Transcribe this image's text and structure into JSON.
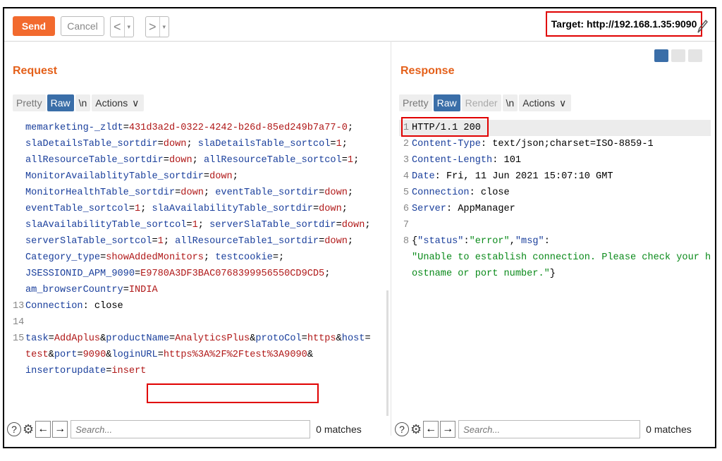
{
  "toolbar": {
    "send_label": "Send",
    "cancel_label": "Cancel",
    "back_glyph": "<",
    "forward_glyph": ">",
    "caret_glyph": "▾",
    "target_text": "Target: http://192.168.1.35:9090",
    "edit_icon": "pencil-icon"
  },
  "layout_icons": [
    "split-horizontal-icon",
    "split-vertical-icon",
    "single-pane-icon"
  ],
  "colors": {
    "accent": "#f26a2e",
    "active_tab": "#3a6ea8",
    "highlight": "#e00000"
  },
  "request": {
    "title": "Request",
    "tabs": [
      "Pretty",
      "Raw",
      "\\n",
      "Actions"
    ],
    "lines": [
      {
        "num": "",
        "parts": [
          {
            "t": "memarketing-_zldt",
            "c": "k"
          },
          {
            "t": "=",
            "c": "p"
          },
          {
            "t": "431d3a2d-0322-4242-b26d-85ed249b7a77-0",
            "c": "v"
          },
          {
            "t": ";",
            "c": "p"
          }
        ]
      },
      {
        "num": "",
        "parts": [
          {
            "t": "slaDetailsTable_sortdir",
            "c": "k"
          },
          {
            "t": "=",
            "c": "p"
          },
          {
            "t": "down",
            "c": "v"
          },
          {
            "t": "; ",
            "c": "p"
          },
          {
            "t": "slaDetailsTable_sortcol",
            "c": "k"
          },
          {
            "t": "=",
            "c": "p"
          },
          {
            "t": "1",
            "c": "v"
          },
          {
            "t": ";",
            "c": "p"
          }
        ]
      },
      {
        "num": "",
        "parts": [
          {
            "t": "allResourceTable_sortdir",
            "c": "k"
          },
          {
            "t": "=",
            "c": "p"
          },
          {
            "t": "down",
            "c": "v"
          },
          {
            "t": "; ",
            "c": "p"
          },
          {
            "t": "allResourceTable_sortcol",
            "c": "k"
          },
          {
            "t": "=",
            "c": "p"
          },
          {
            "t": "1",
            "c": "v"
          },
          {
            "t": ";",
            "c": "p"
          }
        ]
      },
      {
        "num": "",
        "parts": [
          {
            "t": "MonitorAvailablityTable_sortdir",
            "c": "k"
          },
          {
            "t": "=",
            "c": "p"
          },
          {
            "t": "down",
            "c": "v"
          },
          {
            "t": ";",
            "c": "p"
          }
        ]
      },
      {
        "num": "",
        "parts": [
          {
            "t": "MonitorHealthTable_sortdir",
            "c": "k"
          },
          {
            "t": "=",
            "c": "p"
          },
          {
            "t": "down",
            "c": "v"
          },
          {
            "t": "; ",
            "c": "p"
          },
          {
            "t": "eventTable_sortdir",
            "c": "k"
          },
          {
            "t": "=",
            "c": "p"
          },
          {
            "t": "down",
            "c": "v"
          },
          {
            "t": ";",
            "c": "p"
          }
        ]
      },
      {
        "num": "",
        "parts": [
          {
            "t": "eventTable_sortcol",
            "c": "k"
          },
          {
            "t": "=",
            "c": "p"
          },
          {
            "t": "1",
            "c": "v"
          },
          {
            "t": "; ",
            "c": "p"
          },
          {
            "t": "slaAvailabilityTable_sortdir",
            "c": "k"
          },
          {
            "t": "=",
            "c": "p"
          },
          {
            "t": "down",
            "c": "v"
          },
          {
            "t": ";",
            "c": "p"
          }
        ]
      },
      {
        "num": "",
        "parts": [
          {
            "t": "slaAvailabilityTable_sortcol",
            "c": "k"
          },
          {
            "t": "=",
            "c": "p"
          },
          {
            "t": "1",
            "c": "v"
          },
          {
            "t": "; ",
            "c": "p"
          },
          {
            "t": "serverSlaTable_sortdir",
            "c": "k"
          },
          {
            "t": "=",
            "c": "p"
          },
          {
            "t": "down",
            "c": "v"
          },
          {
            "t": ";",
            "c": "p"
          }
        ]
      },
      {
        "num": "",
        "parts": [
          {
            "t": "serverSlaTable_sortcol",
            "c": "k"
          },
          {
            "t": "=",
            "c": "p"
          },
          {
            "t": "1",
            "c": "v"
          },
          {
            "t": "; ",
            "c": "p"
          },
          {
            "t": "allResourceTable1_sortdir",
            "c": "k"
          },
          {
            "t": "=",
            "c": "p"
          },
          {
            "t": "down",
            "c": "v"
          },
          {
            "t": ";",
            "c": "p"
          }
        ]
      },
      {
        "num": "",
        "parts": [
          {
            "t": "Category_type",
            "c": "k"
          },
          {
            "t": "=",
            "c": "p"
          },
          {
            "t": "showAddedMonitors",
            "c": "v"
          },
          {
            "t": "; ",
            "c": "p"
          },
          {
            "t": "testcookie",
            "c": "k"
          },
          {
            "t": "=;",
            "c": "p"
          }
        ]
      },
      {
        "num": "",
        "parts": [
          {
            "t": "JSESSIONID_APM_9090",
            "c": "k"
          },
          {
            "t": "=",
            "c": "p"
          },
          {
            "t": "E9780A3DF3BAC0768399956550CD9CD5",
            "c": "v"
          },
          {
            "t": ";",
            "c": "p"
          }
        ]
      },
      {
        "num": "",
        "parts": [
          {
            "t": "am_browserCountry",
            "c": "k"
          },
          {
            "t": "=",
            "c": "p"
          },
          {
            "t": "INDIA",
            "c": "v"
          }
        ]
      },
      {
        "num": "13",
        "parts": [
          {
            "t": "Connection",
            "c": "k"
          },
          {
            "t": ": close",
            "c": "p"
          }
        ]
      },
      {
        "num": "14",
        "parts": []
      },
      {
        "num": "15",
        "parts": [
          {
            "t": "task",
            "c": "k"
          },
          {
            "t": "=",
            "c": "p"
          },
          {
            "t": "AddAplus",
            "c": "v"
          },
          {
            "t": "&",
            "c": "p"
          },
          {
            "t": "productName",
            "c": "k"
          },
          {
            "t": "=",
            "c": "p"
          },
          {
            "t": "AnalyticsPlus",
            "c": "v"
          },
          {
            "t": "&",
            "c": "p"
          },
          {
            "t": "protoCol",
            "c": "k"
          },
          {
            "t": "=",
            "c": "p"
          },
          {
            "t": "https",
            "c": "v"
          },
          {
            "t": "&",
            "c": "p"
          },
          {
            "t": "host",
            "c": "k"
          },
          {
            "t": "=",
            "c": "p"
          }
        ]
      },
      {
        "num": "",
        "parts": [
          {
            "t": "test",
            "c": "v"
          },
          {
            "t": "&",
            "c": "p"
          },
          {
            "t": "port",
            "c": "k"
          },
          {
            "t": "=",
            "c": "p"
          },
          {
            "t": "9090",
            "c": "v"
          },
          {
            "t": "&",
            "c": "p"
          },
          {
            "t": "loginURL",
            "c": "k"
          },
          {
            "t": "=",
            "c": "p"
          },
          {
            "t": "https%3A%2F%2Ftest%3A9090",
            "c": "v"
          },
          {
            "t": "&",
            "c": "p"
          }
        ]
      },
      {
        "num": "",
        "parts": [
          {
            "t": "insertorupdate",
            "c": "k"
          },
          {
            "t": "=",
            "c": "p"
          },
          {
            "t": "insert",
            "c": "v"
          }
        ]
      }
    ],
    "search_placeholder": "Search...",
    "matches": "0 matches"
  },
  "response": {
    "title": "Response",
    "tabs": [
      "Pretty",
      "Raw",
      "Render",
      "\\n",
      "Actions"
    ],
    "lines": [
      {
        "num": "1",
        "parts": [
          {
            "t": "HTTP/1.1 200",
            "c": "p"
          }
        ]
      },
      {
        "num": "2",
        "parts": [
          {
            "t": "Content-Type",
            "c": "k"
          },
          {
            "t": ": text/json;charset=ISO-8859-1",
            "c": "p"
          }
        ]
      },
      {
        "num": "3",
        "parts": [
          {
            "t": "Content-Length",
            "c": "k"
          },
          {
            "t": ": 101",
            "c": "p"
          }
        ]
      },
      {
        "num": "4",
        "parts": [
          {
            "t": "Date",
            "c": "k"
          },
          {
            "t": ": Fri, 11 Jun 2021 15:07:10 GMT",
            "c": "p"
          }
        ]
      },
      {
        "num": "5",
        "parts": [
          {
            "t": "Connection",
            "c": "k"
          },
          {
            "t": ": close",
            "c": "p"
          }
        ]
      },
      {
        "num": "6",
        "parts": [
          {
            "t": "Server",
            "c": "k"
          },
          {
            "t": ": AppManager",
            "c": "p"
          }
        ]
      },
      {
        "num": "7",
        "parts": []
      },
      {
        "num": "8",
        "parts": [
          {
            "t": "{",
            "c": "p"
          },
          {
            "t": "\"status\"",
            "c": "k"
          },
          {
            "t": ":",
            "c": "p"
          },
          {
            "t": "\"error\"",
            "c": "s"
          },
          {
            "t": ",",
            "c": "p"
          },
          {
            "t": "\"msg\"",
            "c": "k"
          },
          {
            "t": ":",
            "c": "p"
          }
        ]
      },
      {
        "num": "",
        "parts": [
          {
            "t": "\"Unable to establish connection. Please check your h",
            "c": "s"
          }
        ]
      },
      {
        "num": "",
        "parts": [
          {
            "t": "ostname or port number.\"",
            "c": "s"
          },
          {
            "t": "}",
            "c": "p"
          }
        ]
      }
    ],
    "search_placeholder": "Search...",
    "matches": "0 matches"
  }
}
